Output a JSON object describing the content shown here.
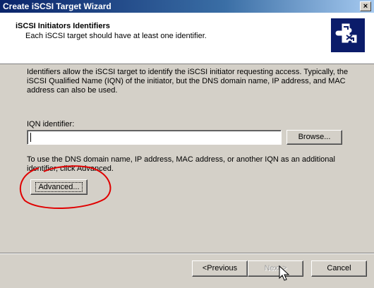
{
  "window": {
    "title": "Create iSCSI Target Wizard",
    "close_label": "×"
  },
  "header": {
    "title": "iSCSI Initiators Identifiers",
    "subtitle": "Each iSCSI target should have at least one identifier.",
    "icon": "wizard-puzzle-icon"
  },
  "body": {
    "description": "Identifiers allow the iSCSI target to identify the iSCSI initiator requesting access. Typically, the iSCSI Qualified Name (IQN) of the initiator, but the DNS domain name, IP address, and MAC address can also be used.",
    "iqn_label": "IQN identifier:",
    "iqn_value": "",
    "browse_label": "Browse...",
    "advanced_text": "To use the DNS domain name, IP address, MAC address, or another IQN as an additional identifier, click Advanced.",
    "advanced_label": "Advanced..."
  },
  "footer": {
    "previous_label": "<Previous",
    "next_label": "Next >",
    "cancel_label": "Cancel"
  },
  "colors": {
    "title_start": "#0a246a",
    "title_end": "#a6caf0",
    "annotation": "#e00000"
  }
}
